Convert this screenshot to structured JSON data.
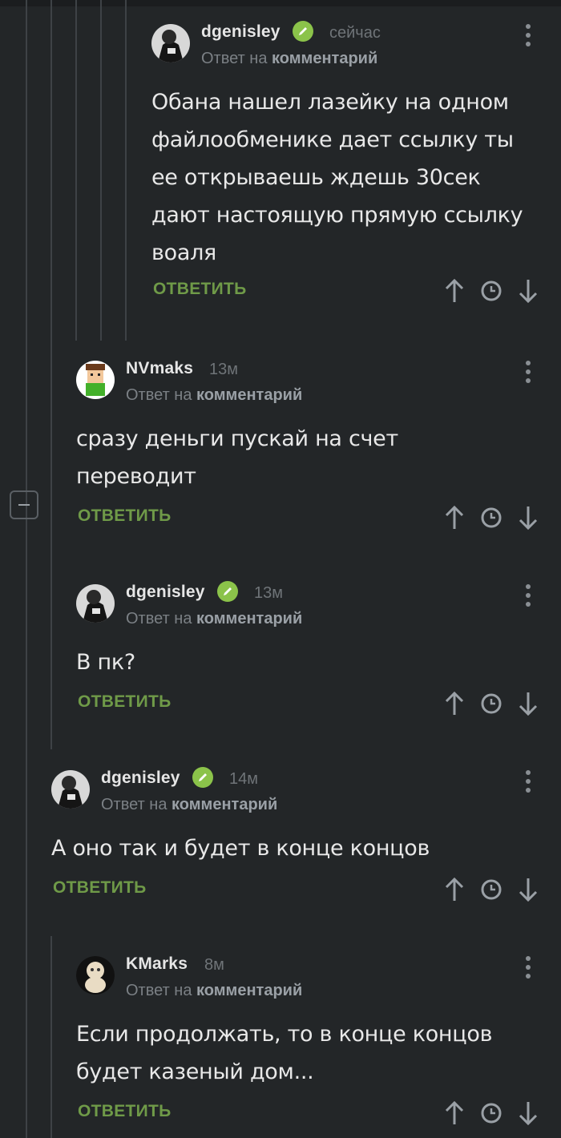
{
  "comments": [
    {
      "author": "dgenisley",
      "time": "сейчас",
      "reply_prefix": "Ответ на",
      "reply_target": "комментарий",
      "text": "Обана нашел лазейку на одном файлообменике дает ссылку ты ее открываешь ждешь 30сек дают настоящую прямую ссылку воаля",
      "reply_label": "ОТВЕТИТЬ",
      "verified": true
    },
    {
      "author": "NVmaks",
      "time": "13м",
      "reply_prefix": "Ответ на",
      "reply_target": "комментарий",
      "text": "сразу деньги пускай на счет переводит",
      "reply_label": "ОТВЕТИТЬ",
      "verified": false
    },
    {
      "author": "dgenisley",
      "time": "13м",
      "reply_prefix": "Ответ на",
      "reply_target": "комментарий",
      "text": "В пк?",
      "reply_label": "ОТВЕТИТЬ",
      "verified": true
    },
    {
      "author": "dgenisley",
      "time": "14м",
      "reply_prefix": "Ответ на",
      "reply_target": "комментарий",
      "text": "А оно так и будет в конце концов",
      "reply_label": "ОТВЕТИТЬ",
      "verified": true
    },
    {
      "author": "KMarks",
      "time": "8м",
      "reply_prefix": "Ответ на",
      "reply_target": "комментарий",
      "text": "Если продолжать, то в конце концов будет казеный дом...",
      "reply_label": "ОТВЕТИТЬ",
      "verified": false
    }
  ],
  "colors": {
    "background": "#232628",
    "reply_green": "#6f9a48",
    "verified_green": "#8bc34a",
    "muted": "#7b8085"
  },
  "icons": {
    "upvote": "arrow-up-icon",
    "timer": "clock-icon",
    "downvote": "arrow-down-icon",
    "verified": "pencil-badge-icon",
    "menu": "kebab-menu-icon",
    "collapse": "minus-icon"
  }
}
